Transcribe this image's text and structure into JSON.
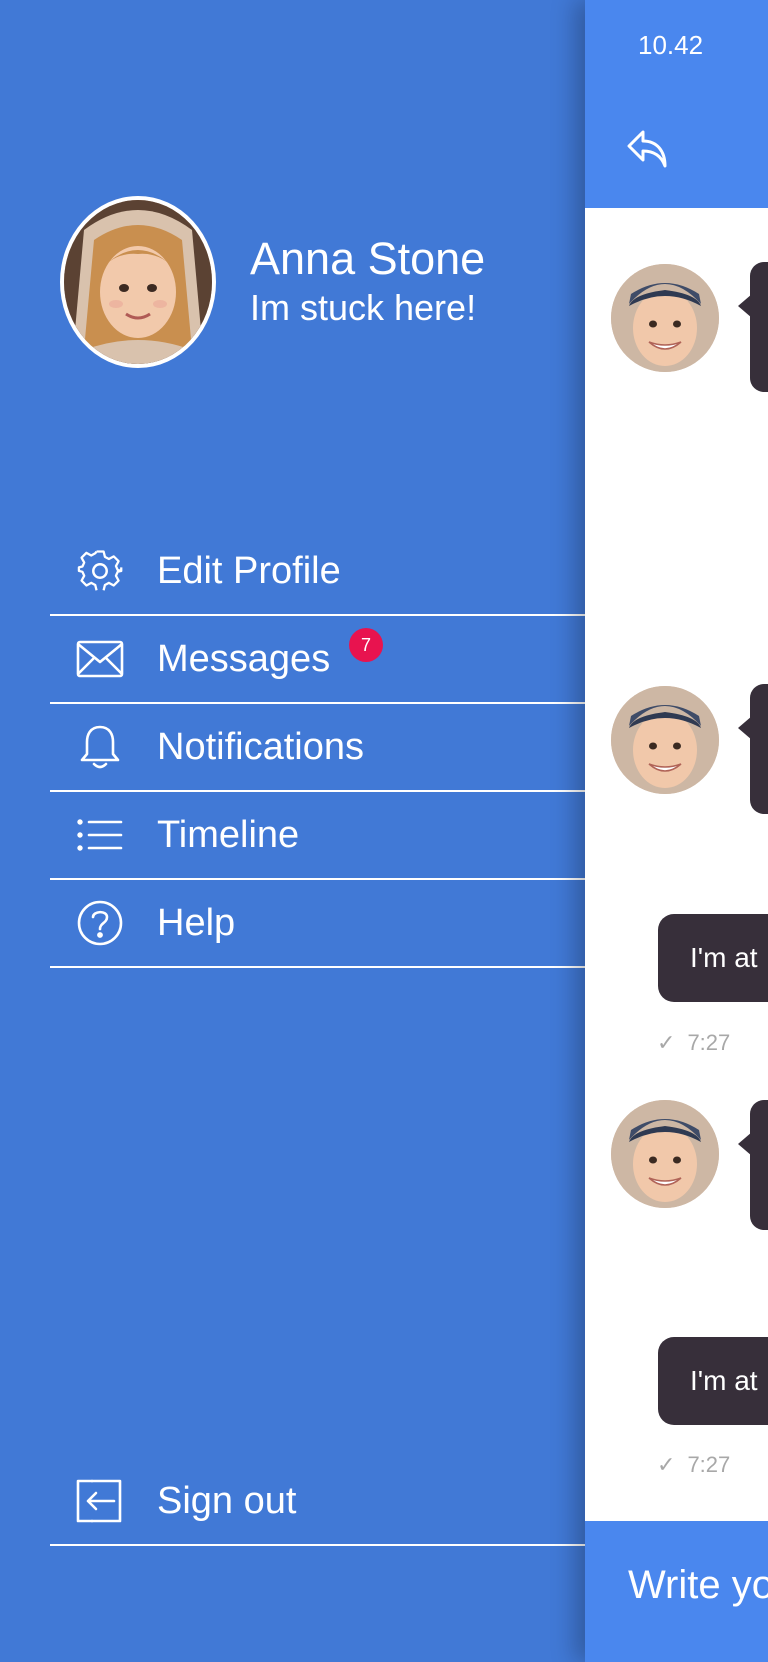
{
  "drawer": {
    "profile": {
      "name": "Anna Stone",
      "status": "Im stuck here!"
    },
    "menu": [
      {
        "label": "Edit Profile",
        "icon": "gear-icon"
      },
      {
        "label": "Messages",
        "icon": "envelope-icon",
        "badge": "7"
      },
      {
        "label": "Notifications",
        "icon": "bell-icon"
      },
      {
        "label": "Timeline",
        "icon": "list-icon"
      },
      {
        "label": "Help",
        "icon": "question-circle-icon"
      }
    ],
    "signout": {
      "label": "Sign out",
      "icon": "sign-out-icon"
    }
  },
  "chat": {
    "status_time": "10.42",
    "messages": [
      {
        "text": "I'm at",
        "time": "7:27"
      },
      {
        "text": "I'm at",
        "time": "7:27"
      }
    ],
    "composer": {
      "placeholder": "Write yo"
    }
  },
  "colors": {
    "drawer_bg": "#4179d6",
    "header_bg": "#4a87ee",
    "bubble": "#372f3a",
    "badge": "#e8134f"
  }
}
